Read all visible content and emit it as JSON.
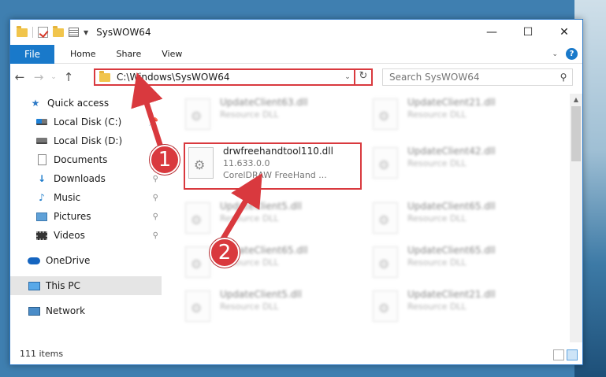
{
  "window": {
    "title": "SysWOW64",
    "controls": {
      "minimize": "—",
      "maximize": "☐",
      "close": "✕"
    }
  },
  "ribbon": {
    "tabs": [
      {
        "label": "File"
      },
      {
        "label": "Home"
      },
      {
        "label": "Share"
      },
      {
        "label": "View"
      }
    ],
    "help": "?"
  },
  "navigation": {
    "address": "C:\\Windows\\SysWOW64",
    "search_placeholder": "Search SysWOW64"
  },
  "sidebar": {
    "items": [
      {
        "label": "Quick access",
        "icon": "star-icon",
        "pinned": false
      },
      {
        "label": "Local Disk (C:)",
        "icon": "drive-icon",
        "pinned": false
      },
      {
        "label": "Local Disk (D:)",
        "icon": "drive-icon",
        "pinned": false
      },
      {
        "label": "Documents",
        "icon": "documents-icon",
        "pinned": true
      },
      {
        "label": "Downloads",
        "icon": "download-icon",
        "pinned": true
      },
      {
        "label": "Music",
        "icon": "music-icon",
        "pinned": true
      },
      {
        "label": "Pictures",
        "icon": "pictures-icon",
        "pinned": true
      },
      {
        "label": "Videos",
        "icon": "videos-icon",
        "pinned": true
      },
      {
        "label": "OneDrive",
        "icon": "onedrive-icon",
        "pinned": false
      },
      {
        "label": "This PC",
        "icon": "this-pc-icon",
        "pinned": false,
        "selected": true
      },
      {
        "label": "Network",
        "icon": "network-icon",
        "pinned": false
      }
    ]
  },
  "files": {
    "highlighted": {
      "name": "drwfreehandtool110.dll",
      "version": "11.633.0.0",
      "description": "CorelDRAW FreeHand ..."
    },
    "blurred": [
      {
        "name": "UpdateClient63.dll",
        "type": "Resource DLL"
      },
      {
        "name": "UpdateClient21.dll",
        "type": "Resource DLL"
      },
      {
        "name": "UpdateClient42.dll",
        "type": "Resource DLL"
      },
      {
        "name": "UpdateClient5.dll",
        "type": "Resource DLL"
      },
      {
        "name": "UpdateClient65.dll",
        "type": "Resource DLL"
      },
      {
        "name": "UpdateClient65.dll",
        "type": "Resource DLL"
      },
      {
        "name": "UpdateClient65.dll",
        "type": "Resource DLL"
      },
      {
        "name": "UpdateClient5.dll",
        "type": "Resource DLL"
      },
      {
        "name": "UpdateClient21.dll",
        "type": "Resource DLL"
      }
    ]
  },
  "status": {
    "items": "111 items"
  },
  "callouts": [
    "1",
    "2"
  ],
  "colors": {
    "accent": "#1979ca",
    "highlight": "#d9393e"
  }
}
